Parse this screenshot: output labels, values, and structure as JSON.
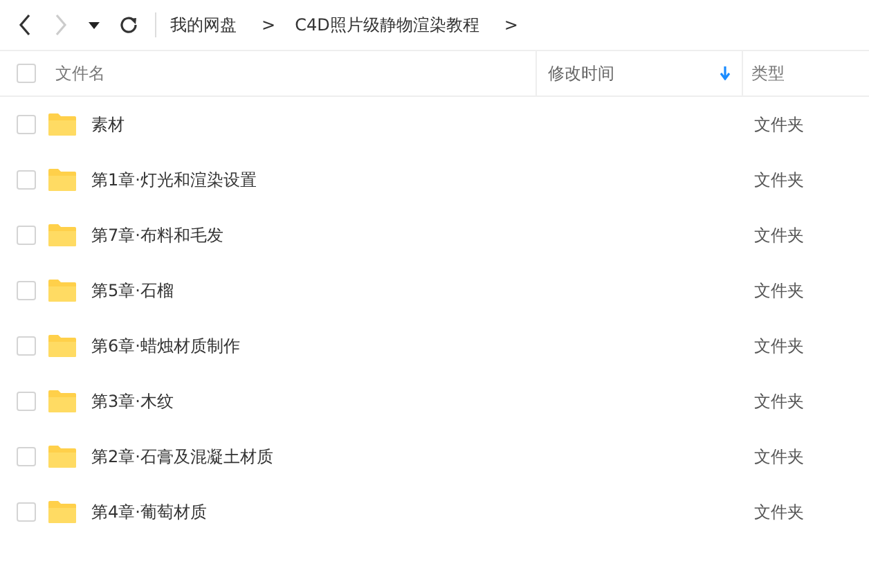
{
  "nav": {
    "back_enabled": true,
    "forward_enabled": false
  },
  "breadcrumb": [
    {
      "label": "我的网盘"
    },
    {
      "label": "C4D照片级静物渲染教程"
    }
  ],
  "separator": ">",
  "columns": [
    {
      "label": "文件名",
      "sorted": false
    },
    {
      "label": "修改时间",
      "sorted": true
    },
    {
      "label": "类型",
      "sorted": false
    }
  ],
  "select_all_checked": false,
  "rows": [
    {
      "name": "素材",
      "type": "文件夹",
      "checked": false
    },
    {
      "name": "第1章·灯光和渲染设置",
      "type": "文件夹",
      "checked": false
    },
    {
      "name": "第7章·布料和毛发",
      "type": "文件夹",
      "checked": false
    },
    {
      "name": "第5章·石榴",
      "type": "文件夹",
      "checked": false
    },
    {
      "name": "第6章·蜡烛材质制作",
      "type": "文件夹",
      "checked": false
    },
    {
      "name": "第3章·木纹",
      "type": "文件夹",
      "checked": false
    },
    {
      "name": "第2章·石膏及混凝土材质",
      "type": "文件夹",
      "checked": false
    },
    {
      "name": "第4章·葡萄材质",
      "type": "文件夹",
      "checked": false
    }
  ]
}
